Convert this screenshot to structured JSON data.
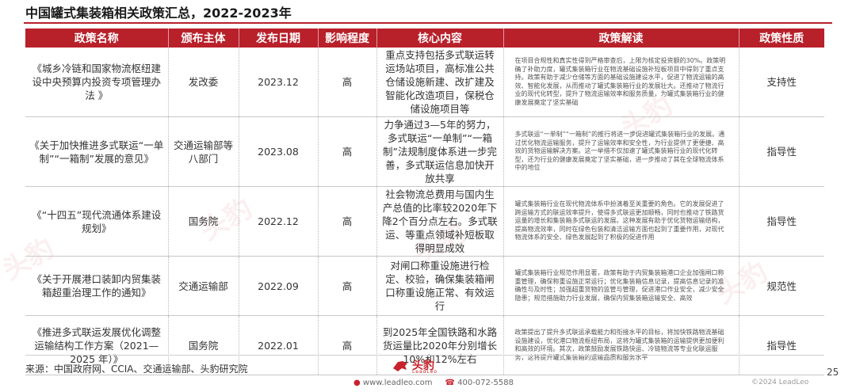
{
  "title": "中国罐式集装箱相关政策汇总，2022-2023年",
  "table": {
    "headers": [
      "政策名称",
      "颁布主体",
      "发布日期",
      "影响程度",
      "核心内容",
      "政策解读",
      "政策性质"
    ],
    "rows": [
      {
        "name": "《城乡冷链和国家物流枢纽建设中央预算内投资专项管理办法 》",
        "issuer": "发改委",
        "date": "2023.12",
        "impact": "高",
        "content": "重点支持包括多式联运转运场站项目，高标准公共仓储设施新建、改扩建及智能化改造项目，保税仓储设施项目等",
        "interpretation": "在项目合规性和真实性得到严格审查后，上限为核定投资额的30%。政策明确了补助力度，罐式集装箱行业在物流基础设施补短板项目中得到了重点支持。政策有助于减少仓储等方面的基础设施建设水平，促进了物流运输的高效、智能化发展，从而推动了罐式集装箱行业的发展壮大。还推动了物流行业的现代化转型，提升了物流运输效率和服务质量，为罐式集装箱行业的健康发展奠定了坚实基础",
        "nature": "支持性"
      },
      {
        "name": "《关于加快推进多式联运“一单制”“一箱制”发展的意见》",
        "issuer": "交通运输部等八部门",
        "date": "2023.08",
        "impact": "高",
        "content": "力争通过3—5年的努力，多式联运“一单制”“一箱制”法规制度体系进一步完善，多式联运信息加快开放共享",
        "interpretation": "多式联运“一单制”“一箱制”的推行将进一步促进罐式集装箱行业的发展。通过优化物流运输服务，提升了运输效率和安全性，为行业提供了更便捷、高效的货物运输解决方案。这一举措不仅加速了罐式集装箱行业的现代化转型，还为行业的健康发展奠定了坚实基础，进一步推动了其在全球物流体系中的地位",
        "nature": "指导性"
      },
      {
        "name": "《“十四五”现代流通体系建设规划》",
        "issuer": "国务院",
        "date": "2022.12",
        "impact": "高",
        "content": "社会物流总费用与国内生产总值的比率较2020年下降2个百分点左右。多式联运、等重点领域补短板取得明显成效",
        "interpretation": "罐式集装箱行业在现代物流体系中扮演着至关重要的角色。它的发展促进了跨运输方式的联运效率提升，使得多式联运更加顺畅，同时也推动了铁路货运量的增长和集装箱多式联运的发展。这种发展有助于优化货物运输结构，提高物流效率，同时在绿色包装和清洁运输方面也起到了重要作用，对现代物流体系的安全、绿色发展起到了积极的促进作用",
        "nature": "指导性"
      },
      {
        "name": "《关于开展港口装卸内贸集装箱超重治理工作的通知》",
        "issuer": "交通运输部",
        "date": "2022.09",
        "impact": "高",
        "content": "对闸口称重设施进行检定、校验，确保集装箱闸口称重设施正常、有效运行",
        "interpretation": "罐式集装箱行业规范作用显著，政策有助于内贸集装箱港口企业加强闸口称重管理，确保称重设施正常运行；优化集装箱信息记录，提高信息记录的准确性与及时性；加强超重货物的监管与管理，促进港口作业安全，减少安全隐患；规范措施助力行业发展，确保内贸集装箱运输安全、高效",
        "nature": "规范性"
      },
      {
        "name": "《推进多式联运发展优化调整运输结构工作方案（2021—2025 年）》",
        "issuer": "国务院",
        "date": "2022.01",
        "impact": "高",
        "content": "到2025年全国铁路和水路货运量比2020年分别增长10%和12%左右",
        "interpretation": "政策提出了提升多式联运承载能力和衔接水平的目标，将加快铁路物流基础设施建设，优化港口物流枢纽布局，这将为罐式集装箱的运输提供更加便利和高效的环境。其次，政策鼓励发展铁路快运、冷链物流等专业化联运服务，这将提升罐式集装箱的运输品质和服务水平",
        "nature": "指导性"
      }
    ]
  },
  "footer": {
    "source": "来源：中国政府网、CCIA、交通运输部、头豹研究院",
    "brand": "头豹",
    "brand_sub": "LeadLeo",
    "website": "www.leadleo.com",
    "phone": "400-072-5588",
    "copyright": "©2024 LeadLeo",
    "page": "25"
  },
  "colors": {
    "accent": "#b8202a",
    "header_text": "#ffffff"
  }
}
